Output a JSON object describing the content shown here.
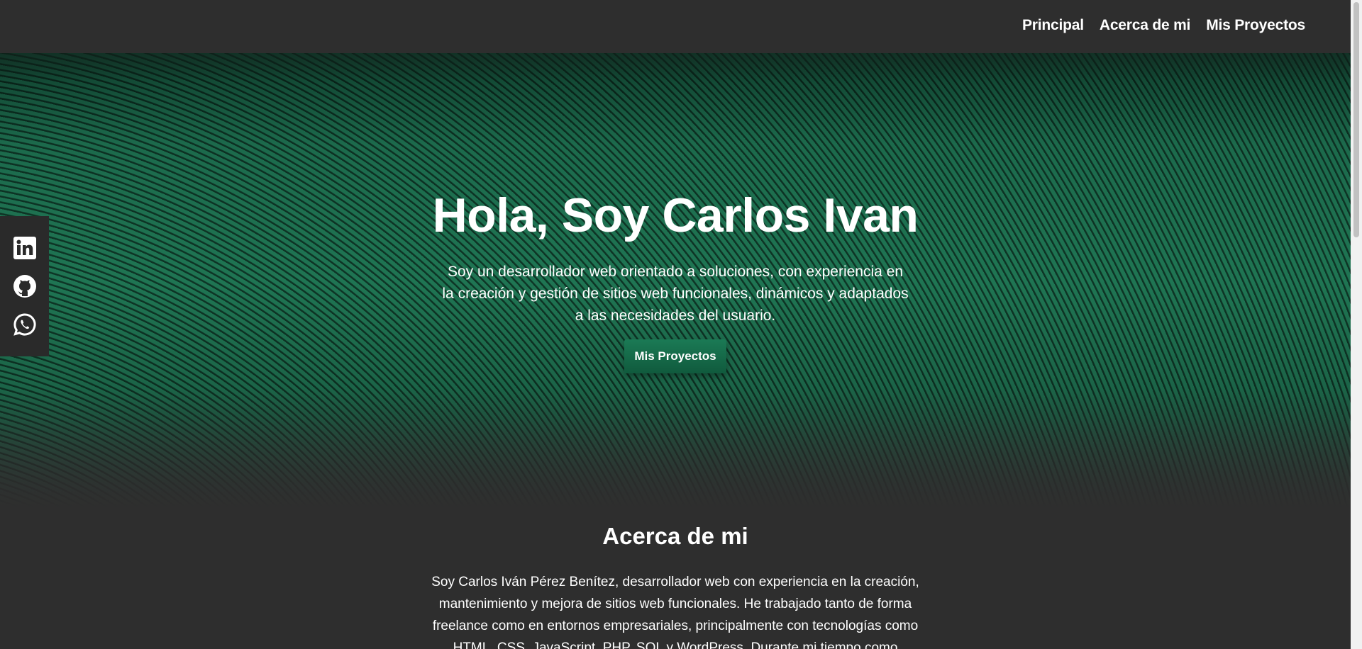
{
  "nav": {
    "items": [
      {
        "label": "Principal"
      },
      {
        "label": "Acerca de mi"
      },
      {
        "label": "Mis Proyectos"
      }
    ]
  },
  "hero": {
    "title": "Hola, Soy Carlos Ivan",
    "description": "Soy un desarrollador web orientado a soluciones, con experiencia en la creación y gestión de sitios web funcionales, dinámicos y adaptados a las necesidades del usuario.",
    "button_label": "Mis Proyectos"
  },
  "social": {
    "icons": [
      "linkedin-icon",
      "github-icon",
      "whatsapp-icon"
    ]
  },
  "about": {
    "title": "Acerca de mi",
    "text": "Soy Carlos Iván Pérez Benítez, desarrollador web con experiencia en la creación, mantenimiento y mejora de sitios web funcionales. He trabajado tanto de forma freelance como en entornos empresariales, principalmente con tecnologías como HTML, CSS, JavaScript, PHP, SQL y WordPress. Durante mi tiempo como"
  },
  "colors": {
    "background": "#2e2e2e",
    "accent": "#1b7a55",
    "hero_green": "#1f7553"
  }
}
